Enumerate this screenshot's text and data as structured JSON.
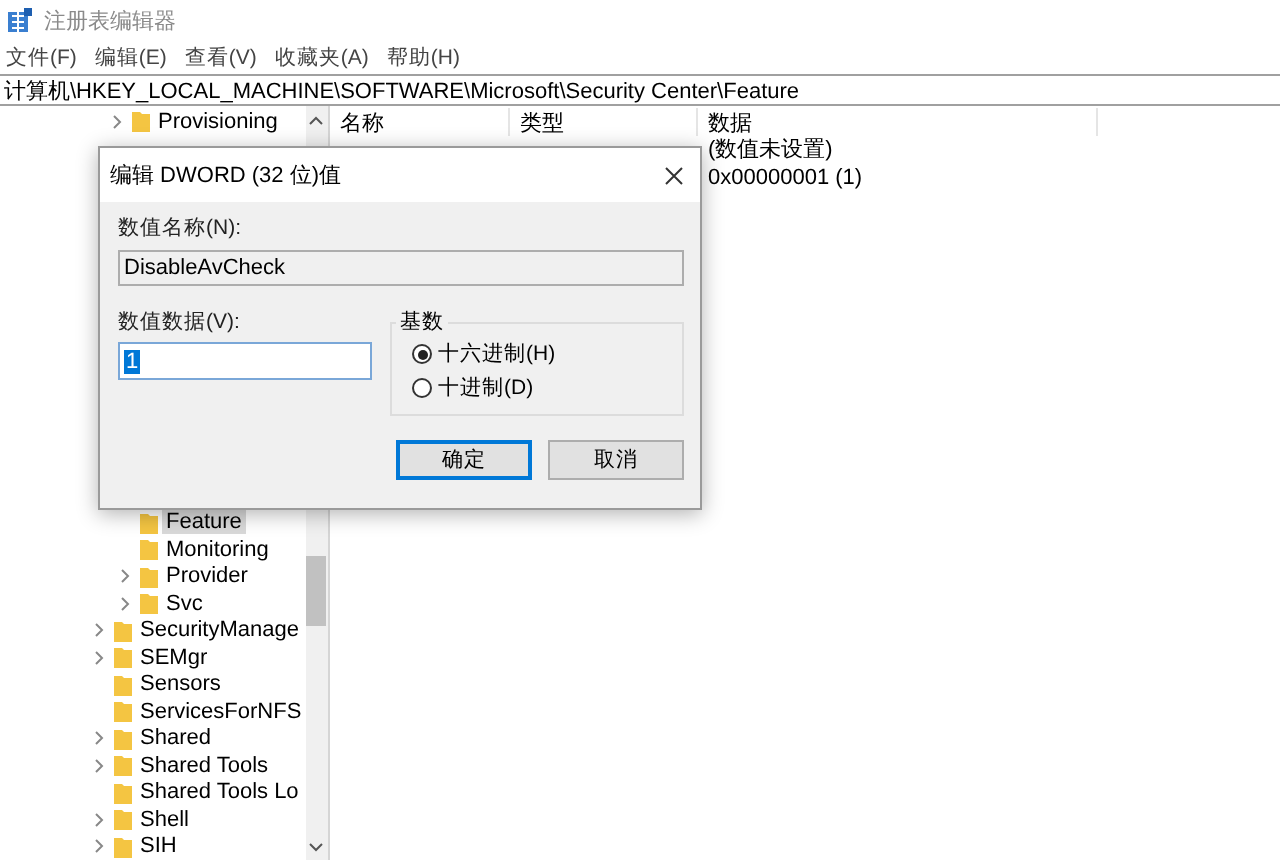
{
  "window": {
    "title": "注册表编辑器"
  },
  "menu": [
    "文件(F)",
    "编辑(E)",
    "查看(V)",
    "收藏夹(A)",
    "帮助(H)"
  ],
  "address": "计算机\\HKEY_LOCAL_MACHINE\\SOFTWARE\\Microsoft\\Security Center\\Feature",
  "tree": {
    "top": [
      {
        "label": "Provisioning",
        "expandable": true,
        "selected": false
      }
    ],
    "bottom": [
      {
        "children": [
          {
            "label": "Feature",
            "expandable": false,
            "selected": true
          },
          {
            "label": "Monitoring",
            "expandable": false,
            "selected": false
          },
          {
            "label": "Provider",
            "expandable": true,
            "selected": false
          },
          {
            "label": "Svc",
            "expandable": true,
            "selected": false
          }
        ]
      },
      {
        "label": "SecurityManage",
        "expandable": true,
        "selected": false
      },
      {
        "label": "SEMgr",
        "expandable": true,
        "selected": false
      },
      {
        "label": "Sensors",
        "expandable": false,
        "selected": false
      },
      {
        "label": "ServicesForNFS",
        "expandable": false,
        "selected": false
      },
      {
        "label": "Shared",
        "expandable": true,
        "selected": false
      },
      {
        "label": "Shared Tools",
        "expandable": true,
        "selected": false
      },
      {
        "label": "Shared Tools Lo",
        "expandable": false,
        "selected": false
      },
      {
        "label": "Shell",
        "expandable": true,
        "selected": false
      },
      {
        "label": "SIH",
        "expandable": true,
        "selected": false
      }
    ]
  },
  "list": {
    "columns": [
      "名称",
      "类型",
      "数据"
    ],
    "rows": [
      {
        "data": "(数值未设置)"
      },
      {
        "data": "0x00000001 (1)"
      }
    ]
  },
  "dialog": {
    "title": "编辑 DWORD (32 位)值",
    "name_label": "数值名称(N):",
    "name_value": "DisableAvCheck",
    "data_label": "数值数据(V):",
    "data_value": "1",
    "base_label": "基数",
    "bases": [
      {
        "label": "十六进制(H)",
        "selected": true
      },
      {
        "label": "十进制(D)",
        "selected": false
      }
    ],
    "buttons": [
      {
        "label": "确定",
        "default": true
      },
      {
        "label": "取消",
        "default": false
      }
    ]
  }
}
